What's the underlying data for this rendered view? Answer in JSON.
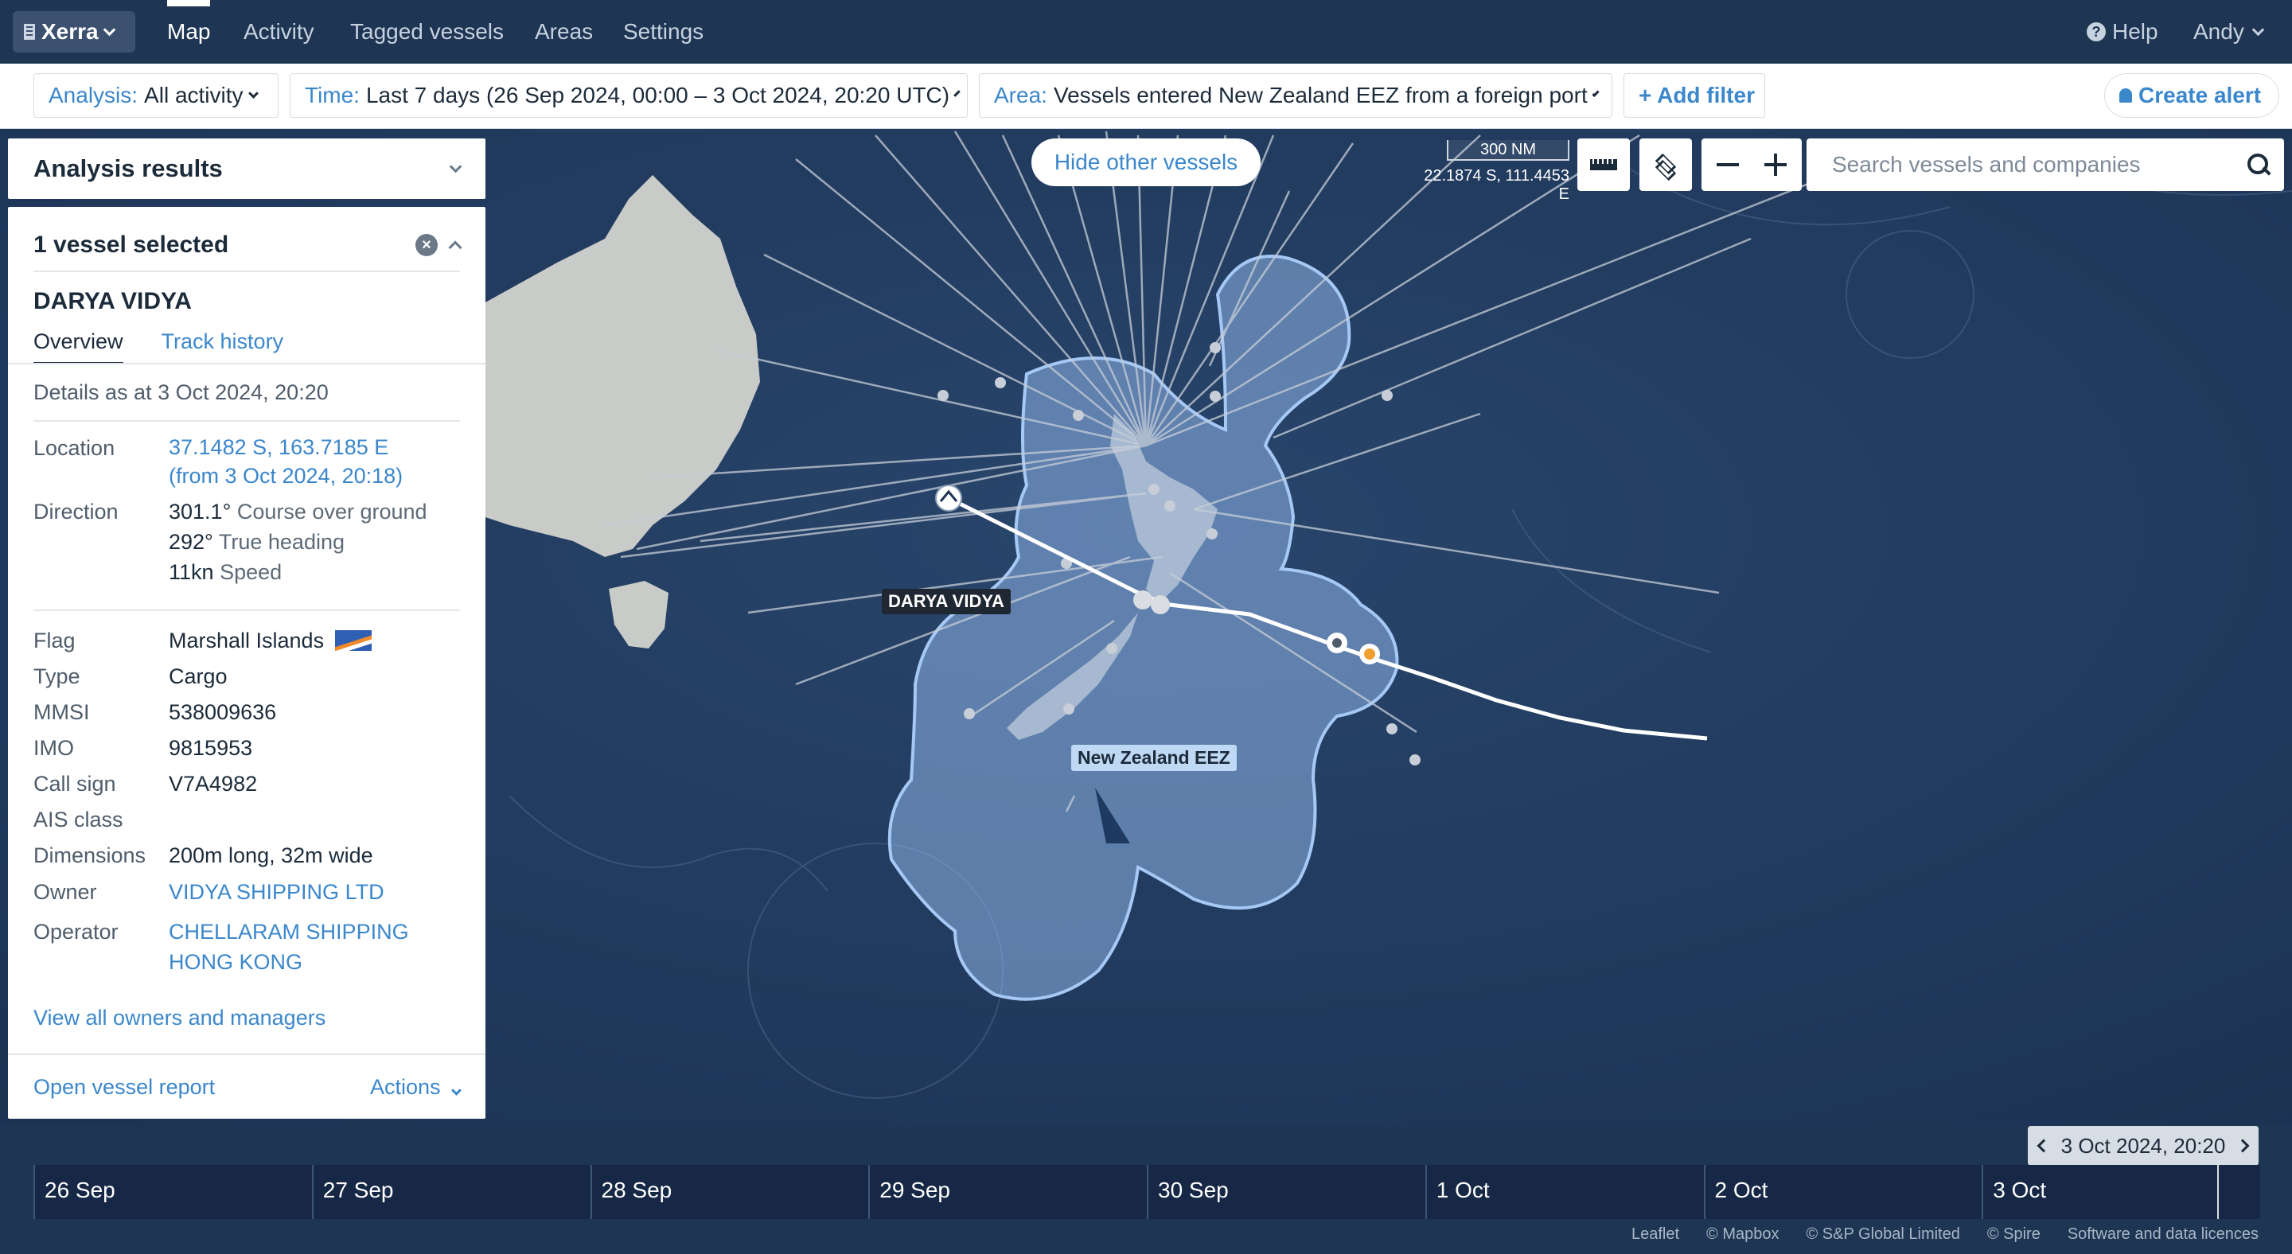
{
  "org": {
    "name": "Xerra"
  },
  "nav": {
    "items": [
      {
        "label": "Map",
        "active": true
      },
      {
        "label": "Activity",
        "active": false
      },
      {
        "label": "Tagged vessels",
        "active": false
      },
      {
        "label": "Areas",
        "active": false
      },
      {
        "label": "Settings",
        "active": false
      }
    ],
    "help": "Help",
    "user": "Andy"
  },
  "filters": {
    "analysis": {
      "key": "Analysis:",
      "value": "All activity"
    },
    "time": {
      "key": "Time:",
      "value": "Last 7 days (26 Sep 2024, 00:00 – 3 Oct 2024, 20:20 UTC)"
    },
    "area": {
      "key": "Area:",
      "value": "Vessels entered New Zealand EEZ from a foreign port"
    },
    "add_filter": "+ Add filter",
    "create_alert": "Create alert"
  },
  "map": {
    "hide_other_vessels": "Hide other vessels",
    "scale": "300 NM",
    "coords": "22.1874 S, 111.4453 E",
    "search_placeholder": "Search vessels and companies",
    "vessel_label": "DARYA VIDYA",
    "area_label": "New Zealand EEZ",
    "track_color": "#ffffff",
    "eez_fill": "#8fb4e8"
  },
  "panel": {
    "analysis_results": "Analysis results",
    "selected": "1 vessel selected",
    "vessel_name": "DARYA VIDYA",
    "tabs": [
      "Overview",
      "Track history"
    ],
    "details_as_at": "Details as at 3 Oct 2024, 20:20",
    "location_label": "Location",
    "location_value": "37.1482 S, 163.7185 E",
    "location_from": "(from 3 Oct 2024, 20:18)",
    "direction_label": "Direction",
    "direction": [
      {
        "value": "301.1°",
        "label": "Course over ground"
      },
      {
        "value": "292°",
        "label": "True heading"
      },
      {
        "value": "11kn",
        "label": "Speed"
      }
    ],
    "fields": {
      "flag_label": "Flag",
      "flag": "Marshall Islands",
      "type_label": "Type",
      "type": "Cargo",
      "mmsi_label": "MMSI",
      "mmsi": "538009636",
      "imo_label": "IMO",
      "imo": "9815953",
      "callsign_label": "Call sign",
      "callsign": "V7A4982",
      "ais_label": "AIS class",
      "ais": "",
      "dimensions_label": "Dimensions",
      "dimensions": "200m long, 32m wide",
      "owner_label": "Owner",
      "owner": "VIDYA SHIPPING LTD",
      "operator_label": "Operator",
      "operator_line1": "CHELLARAM SHIPPING",
      "operator_line2": "HONG KONG"
    },
    "view_all": "View all owners and managers",
    "open_report": "Open vessel report",
    "actions": "Actions"
  },
  "timeline": {
    "current": "3 Oct 2024, 20:20",
    "days": [
      "26 Sep",
      "27 Sep",
      "28 Sep",
      "29 Sep",
      "30 Sep",
      "1 Oct",
      "2 Oct",
      "3 Oct"
    ]
  },
  "credits": [
    "Leaflet",
    "© Mapbox",
    "© S&P Global Limited",
    "© Spire",
    "Software and data licences"
  ]
}
